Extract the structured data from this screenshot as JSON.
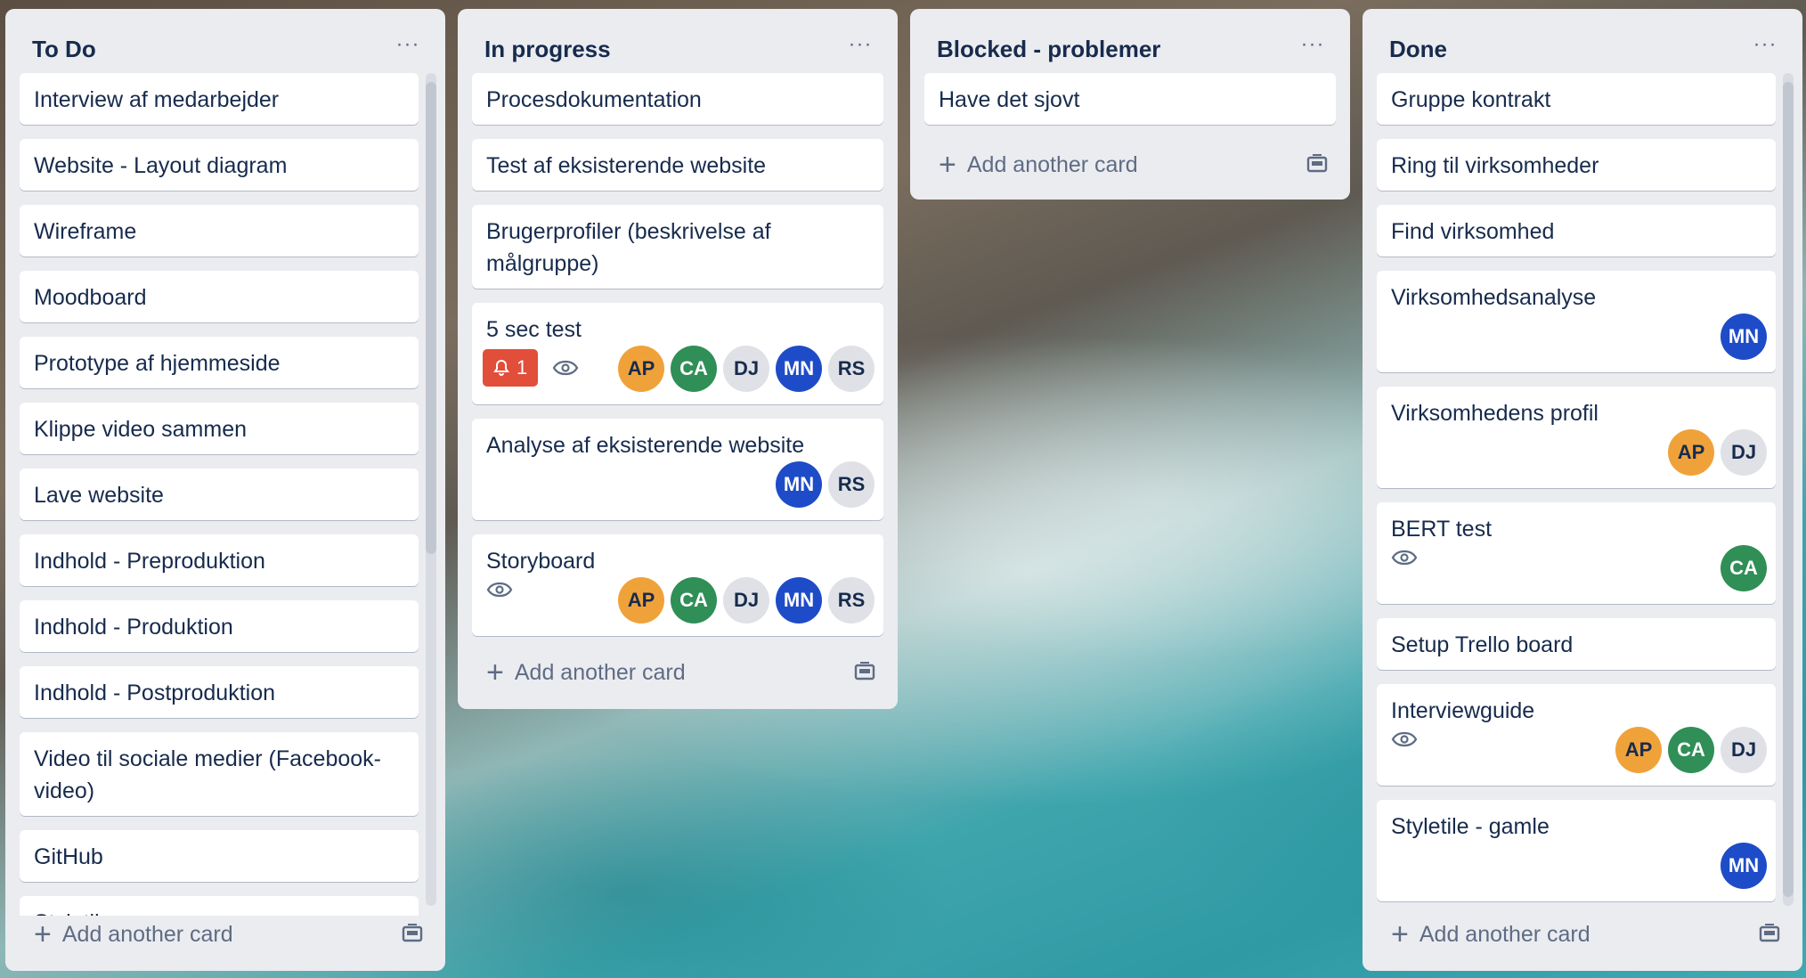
{
  "lists": [
    {
      "title": "To Do",
      "cards": [
        "Interview af medarbejder",
        "Website - Layout diagram",
        "Wireframe",
        "Moodboard",
        "Prototype af hjemmeside",
        "Klippe video sammen",
        "Lave website",
        "Indhold - Preproduktion",
        "Indhold - Produktion",
        "Indhold - Postproduktion",
        "Video til sociale medier (Facebook-video)",
        "GitHub",
        "Styletile - nye"
      ],
      "add_label": "Add another card"
    },
    {
      "title": "In progress",
      "cards": [
        "Procesdokumentation",
        "Test af eksisterende website",
        "Brugerprofiler (beskrivelse af målgruppe)",
        "5 sec test",
        "Analyse af eksisterende website",
        "Storyboard"
      ],
      "notification_count": "1",
      "add_label": "Add another card"
    },
    {
      "title": "Blocked - problemer",
      "cards": [
        "Have det sjovt"
      ],
      "add_label": "Add another card"
    },
    {
      "title": "Done",
      "cards": [
        "Gruppe kontrakt",
        "Ring til virksomheder",
        "Find virksomhed",
        "Virksomhedsanalyse",
        "Virksomhedens profil",
        "BERT test",
        "Setup Trello board",
        "Interviewguide",
        "Styletile - gamle"
      ],
      "add_label": "Add another card"
    }
  ],
  "members": {
    "ap": "AP",
    "ca": "CA",
    "dj": "DJ",
    "mn": "MN",
    "rs": "RS"
  },
  "more_label": "···",
  "colors": {
    "list_bg": "#ebecf0",
    "card_bg": "#ffffff",
    "text": "#172b4d",
    "muted": "#5e6c84",
    "notification": "#e14e3a",
    "avatar_orange": "#f0a23a",
    "avatar_green": "#2f8f57",
    "avatar_gray": "#dfe1e6",
    "avatar_blue": "#1e4cc8"
  }
}
